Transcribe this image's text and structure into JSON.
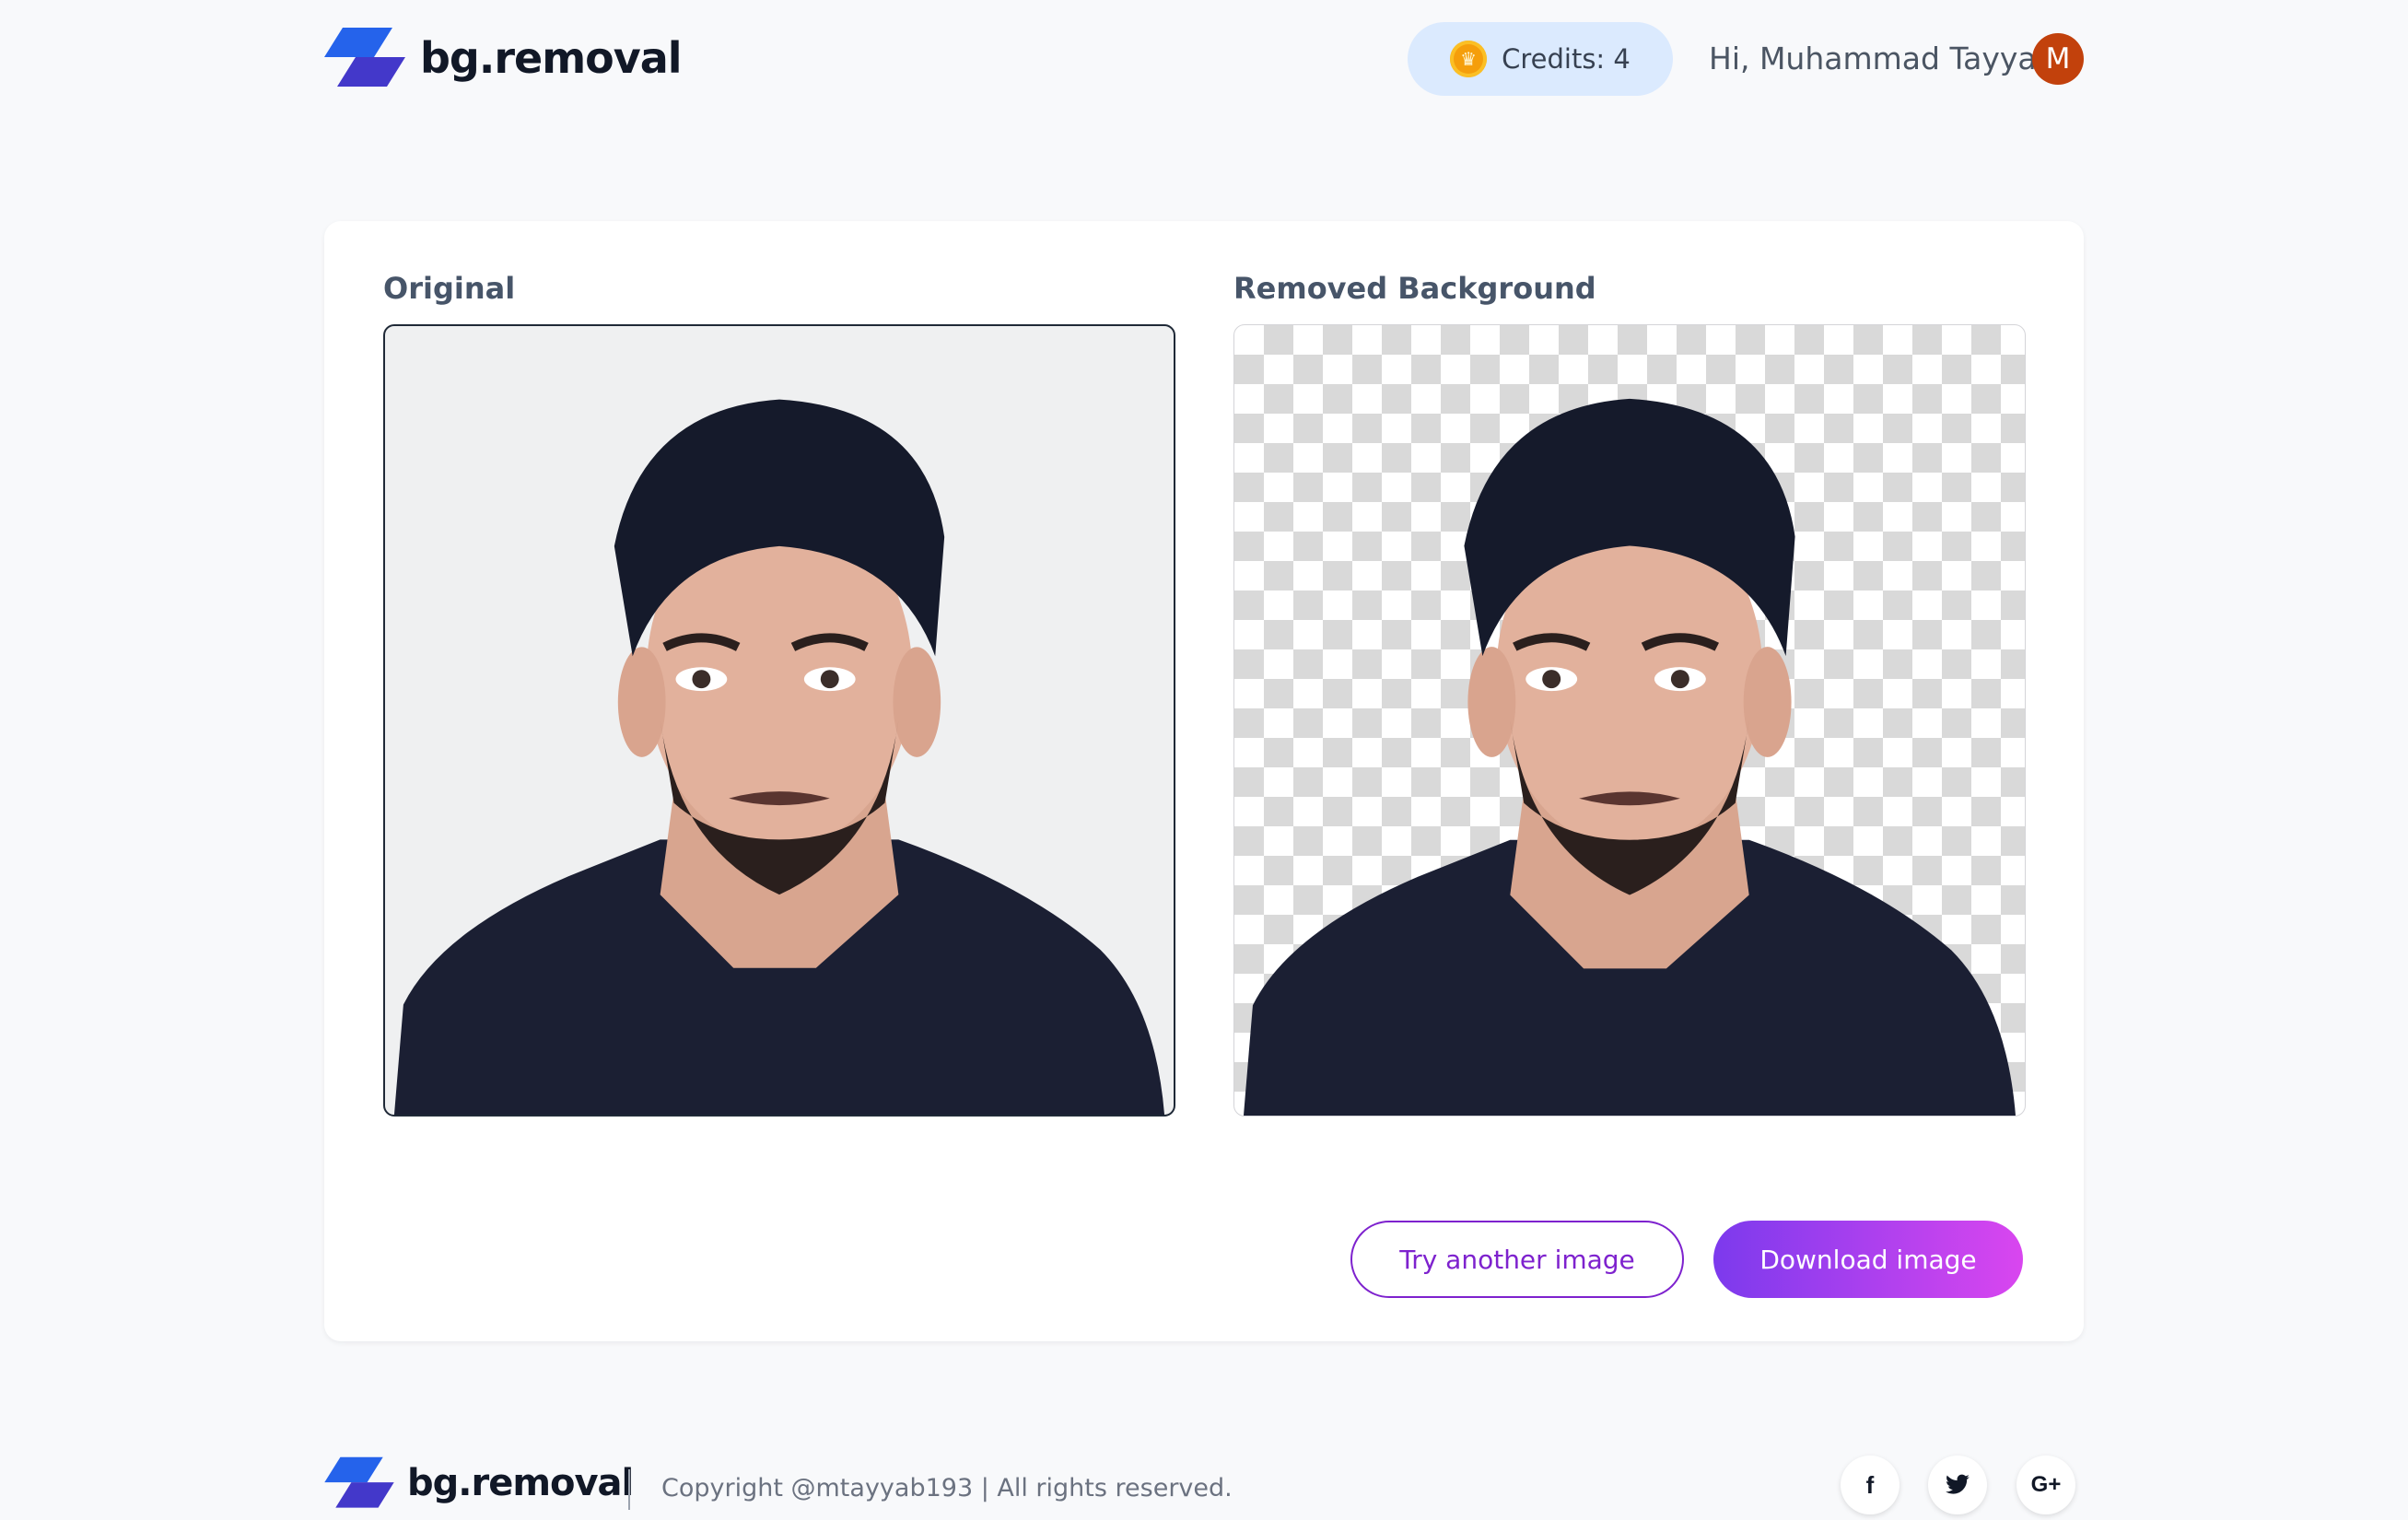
{
  "header": {
    "brand": "bg.removal",
    "credits_label": "Credits: 4",
    "greeting": "Hi, Muhammad Tayyab",
    "avatar_initial": "M",
    "coin_icon": "coin-icon"
  },
  "main": {
    "original_title": "Original",
    "removed_title": "Removed Background",
    "try_another_label": "Try another image",
    "download_label": "Download image"
  },
  "footer": {
    "brand": "bg.removal",
    "copyright": "Copyright @mtayyab193 | All rights reserved.",
    "social": [
      {
        "icon": "facebook-icon",
        "glyph": "f"
      },
      {
        "icon": "twitter-icon",
        "glyph": "🐦"
      },
      {
        "icon": "google-plus-icon",
        "glyph": "G+"
      }
    ]
  },
  "colors": {
    "accent": "#7e22ce",
    "gradient_start": "#7c3aed",
    "gradient_end": "#d946ef",
    "logo_blue": "#2563eb",
    "credits_bg": "#dbeafe",
    "avatar_bg": "#c2410c"
  }
}
